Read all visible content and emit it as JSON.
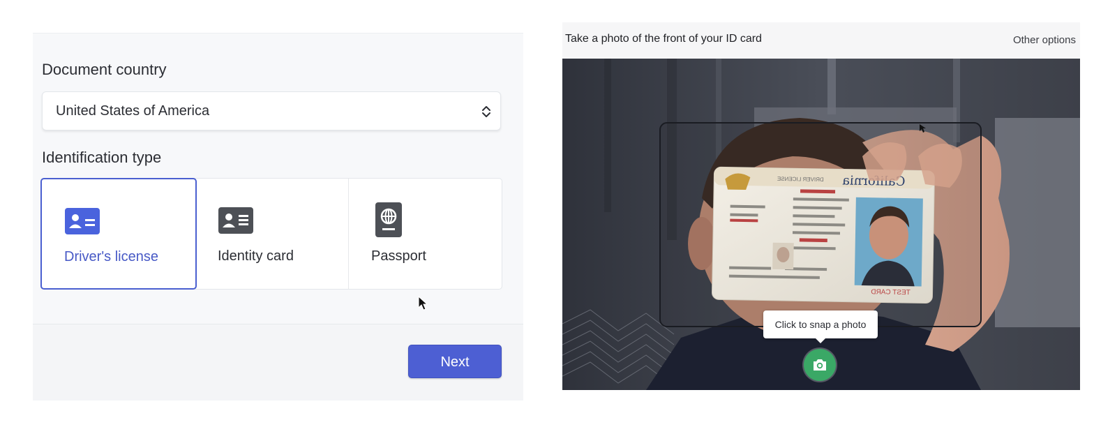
{
  "document_form": {
    "country_label": "Document country",
    "country_value": "United States of America",
    "id_type_label": "Identification type",
    "id_options": [
      {
        "label": "Driver's license",
        "icon": "id-card-icon",
        "selected": true
      },
      {
        "label": "Identity card",
        "icon": "id-card-icon",
        "selected": false
      },
      {
        "label": "Passport",
        "icon": "passport-icon",
        "selected": false
      }
    ],
    "next_label": "Next"
  },
  "capture": {
    "title": "Take a photo of the front of your ID card",
    "other_options_label": "Other options",
    "tooltip": "Click to snap a photo",
    "camera_icon": "camera-icon",
    "card": {
      "state": "California",
      "header": "DRIVER LICENSE",
      "footer": "TEST CARD"
    }
  },
  "colors": {
    "accent": "#4d5fd3",
    "selected_text": "#4759c6",
    "snap_button": "#3aa866"
  }
}
